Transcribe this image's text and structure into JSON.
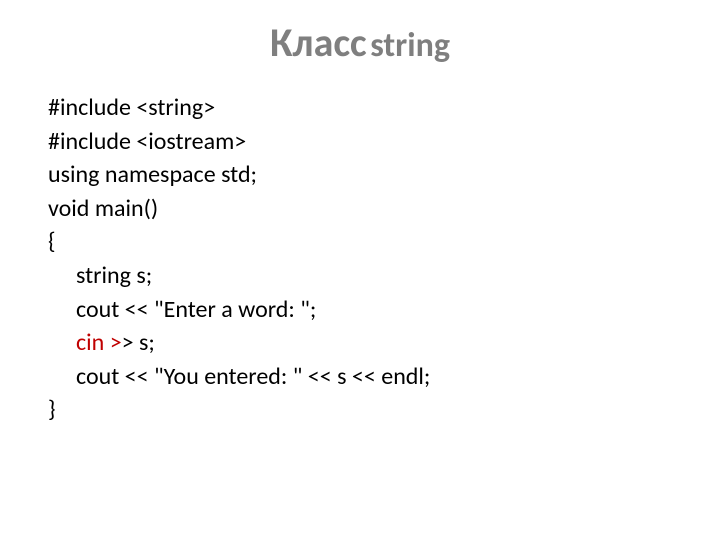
{
  "title": {
    "word1": "Класс",
    "word2": "string"
  },
  "code": {
    "line1": "#include <string>",
    "line2": "#include <iostream>",
    "line3": "using namespace std;",
    "line4": "void main()",
    "line5": "{",
    "line6": "string s;",
    "line7": "cout << \"Enter a word: \";",
    "line8a": "cin >",
    "line8b": "> s;",
    "line9": "cout << \"You entered: \" << s << endl;",
    "line10": "}"
  }
}
